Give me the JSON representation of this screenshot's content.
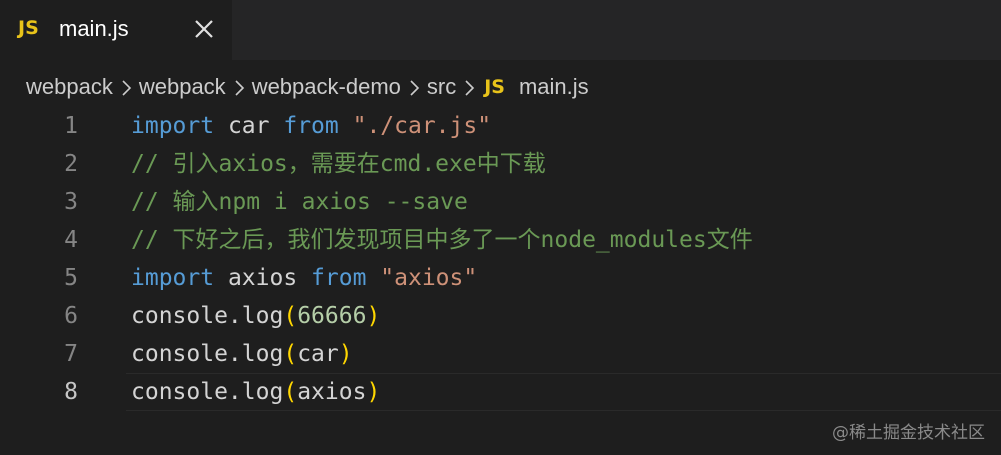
{
  "tab": {
    "lang_badge": "JS",
    "title": "main.js"
  },
  "breadcrumb": {
    "items": [
      "webpack",
      "webpack",
      "webpack-demo",
      "src"
    ],
    "file_badge": "JS",
    "file": "main.js"
  },
  "editor": {
    "lines": [
      {
        "n": "1",
        "tokens": [
          [
            "kw",
            "import"
          ],
          [
            "id",
            " car "
          ],
          [
            "kw",
            "from"
          ],
          [
            "id",
            " "
          ],
          [
            "str",
            "\"./car.js\""
          ]
        ]
      },
      {
        "n": "2",
        "tokens": [
          [
            "cm",
            "// 引入axios，需要在cmd.exe中下载"
          ]
        ]
      },
      {
        "n": "3",
        "tokens": [
          [
            "cm",
            "// 输入npm i axios --save"
          ]
        ]
      },
      {
        "n": "4",
        "tokens": [
          [
            "cm",
            "// 下好之后，我们发现项目中多了一个node_modules文件"
          ]
        ]
      },
      {
        "n": "5",
        "tokens": [
          [
            "kw",
            "import"
          ],
          [
            "id",
            " axios "
          ],
          [
            "kw",
            "from"
          ],
          [
            "id",
            " "
          ],
          [
            "str",
            "\"axios\""
          ]
        ]
      },
      {
        "n": "6",
        "tokens": [
          [
            "id",
            "console.log"
          ],
          [
            "br",
            "("
          ],
          [
            "num",
            "66666"
          ],
          [
            "br",
            ")"
          ]
        ]
      },
      {
        "n": "7",
        "tokens": [
          [
            "id",
            "console.log"
          ],
          [
            "br",
            "("
          ],
          [
            "id",
            "car"
          ],
          [
            "br",
            ")"
          ]
        ]
      },
      {
        "n": "8",
        "tokens": [
          [
            "id",
            "console.log"
          ],
          [
            "br",
            "("
          ],
          [
            "id",
            "axios"
          ],
          [
            "br",
            ")"
          ]
        ]
      }
    ],
    "active_line": "8"
  },
  "watermark": "@稀土掘金技术社区",
  "colors": {
    "background": "#1e1e1e",
    "tabbar": "#252526",
    "js_badge": "#e8c31a",
    "keyword": "#569cd6",
    "string": "#ce9178",
    "comment": "#6a9955",
    "number": "#b5cea8",
    "bracket": "#ffd700"
  }
}
